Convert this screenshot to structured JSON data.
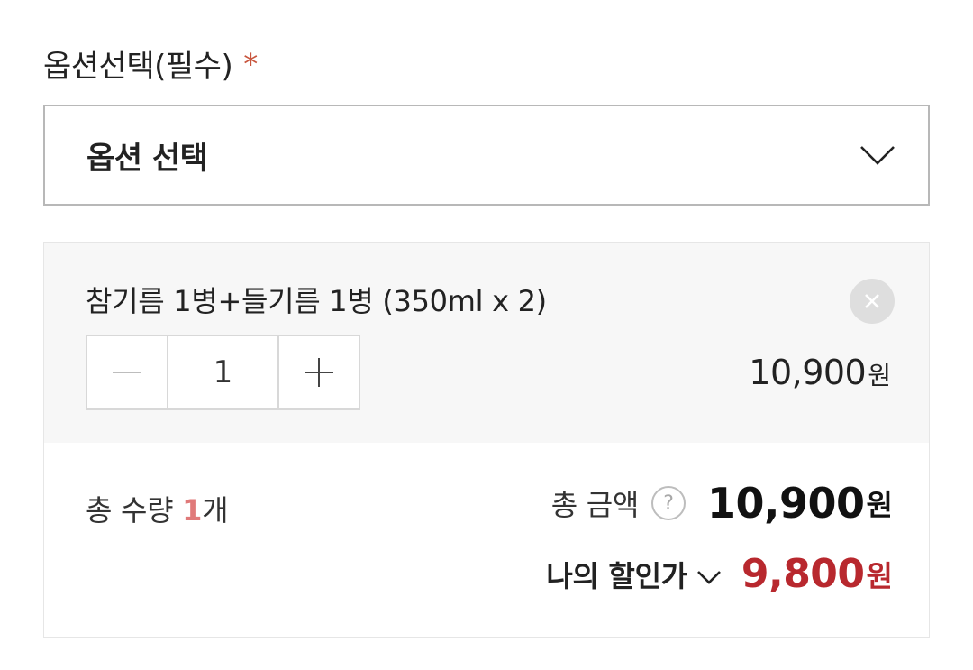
{
  "option_section": {
    "label": "옵션선택(필수)",
    "required_mark": "*",
    "select_label": "옵션 선택",
    "select_icon": "chevron-down-icon"
  },
  "item": {
    "name": "참기름 1병+들기름 1병 (350ml x 2)",
    "quantity": "1",
    "price": "10,900",
    "price_unit": "원",
    "remove_icon": "close-icon"
  },
  "summary": {
    "total_qty_prefix": "총 수량",
    "total_qty_count": "1",
    "total_qty_suffix": "개",
    "total_label": "총 금액",
    "help_glyph": "?",
    "total_amount": "10,900",
    "total_unit": "원",
    "discount_label": "나의 할인가",
    "discount_amount": "9,800",
    "discount_unit": "원"
  },
  "colors": {
    "accent_red": "#b8282e",
    "required_star": "#c8553d",
    "count_pink": "#e07a7a",
    "box_bg": "#f7f7f7"
  }
}
